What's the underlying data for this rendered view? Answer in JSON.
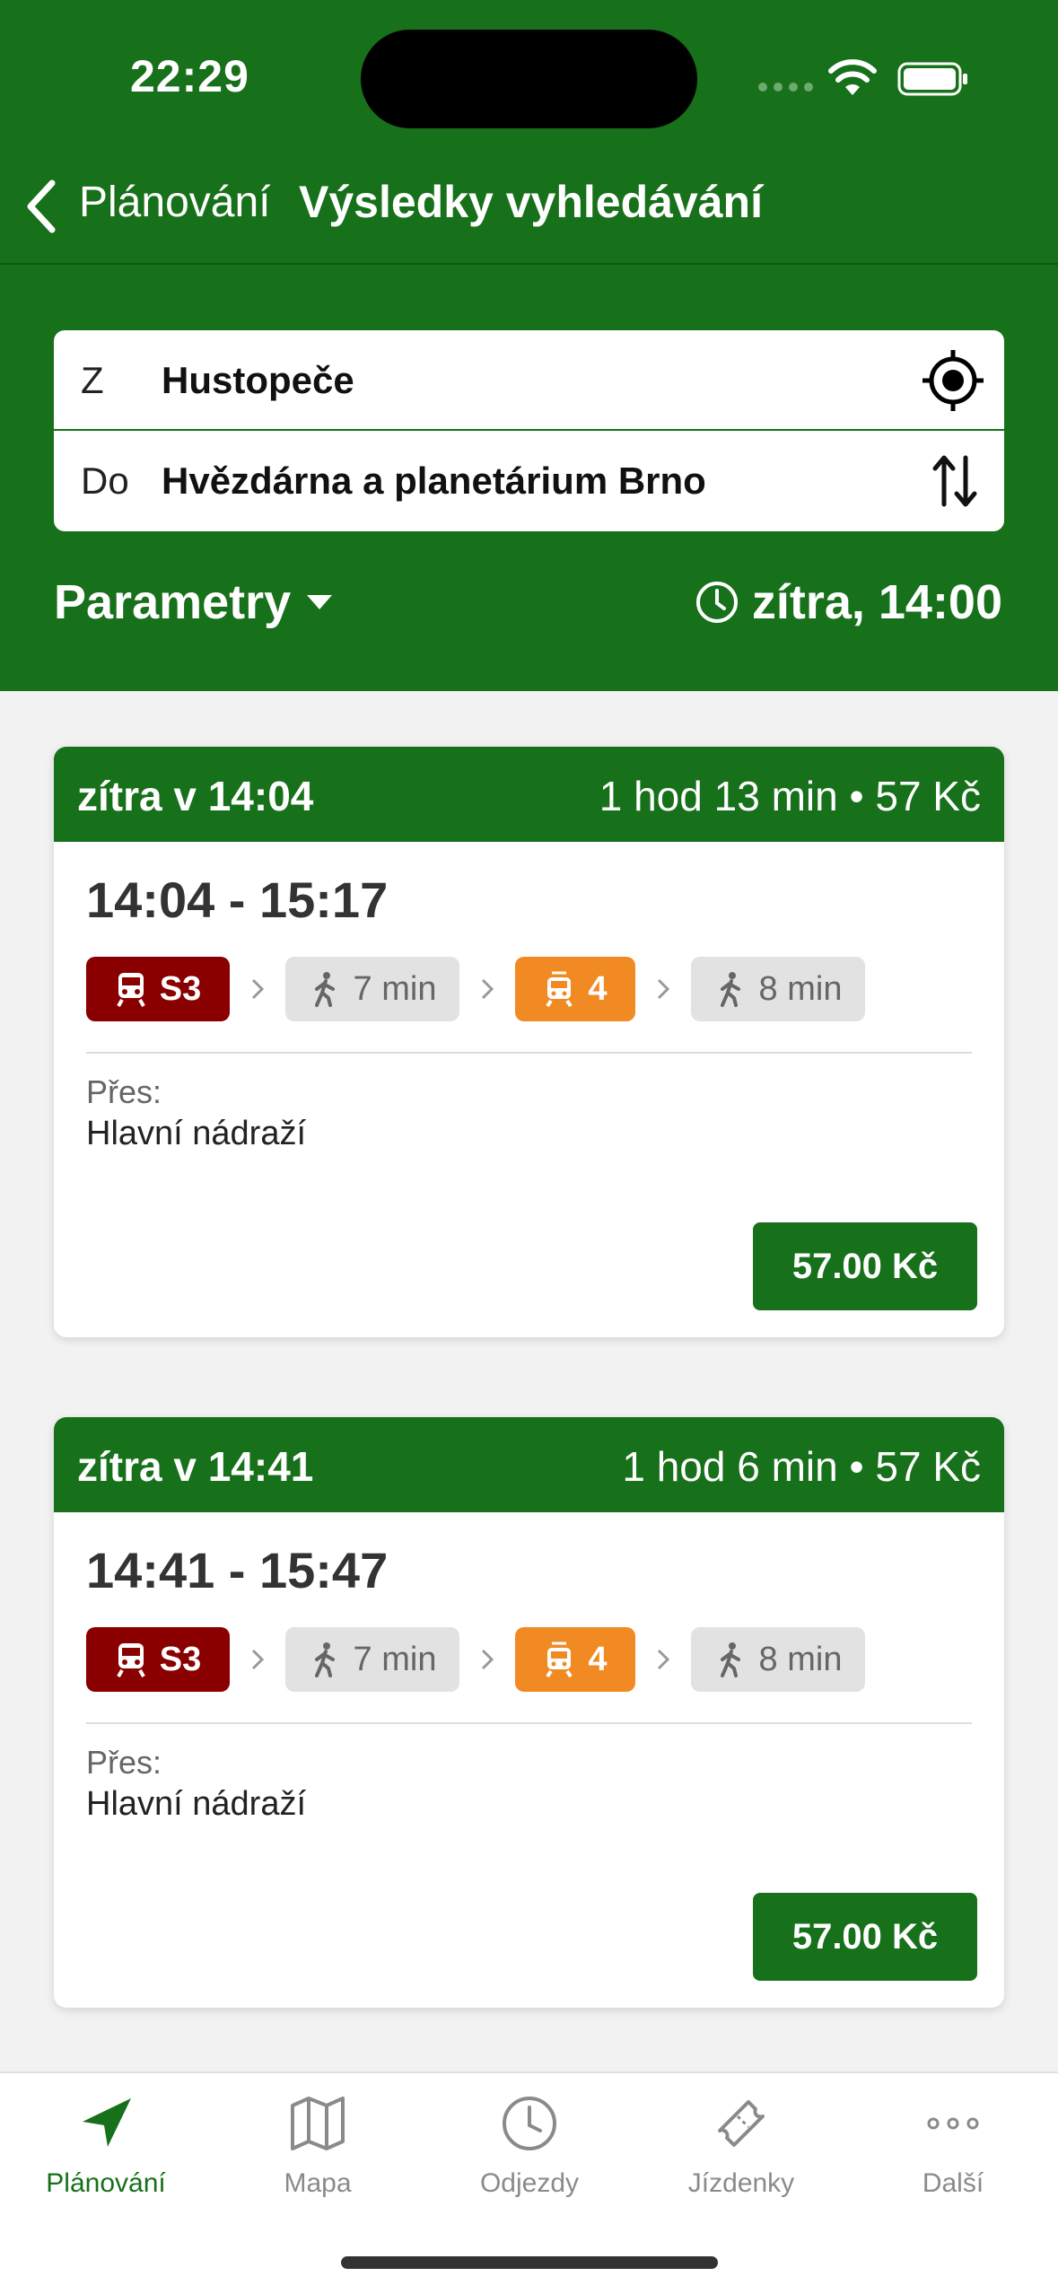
{
  "status_bar": {
    "time": "22:29"
  },
  "nav": {
    "back_label": "Plánování",
    "title": "Výsledky vyhledávání"
  },
  "route": {
    "from_prefix": "Z",
    "from_value": "Hustopeče",
    "to_prefix": "Do",
    "to_value": "Hvězdárna a planetárium Brno"
  },
  "params": {
    "label": "Parametry",
    "datetime": "zítra, 14:00"
  },
  "results": [
    {
      "header_left": "zítra v 14:04",
      "header_right": "1 hod 13 min • 57 Kč",
      "times": "14:04 - 15:17",
      "leg_train": "S3",
      "leg_walk1": "7 min",
      "leg_tram": "4",
      "leg_walk2": "8 min",
      "via_label": "Přes:",
      "via_value": "Hlavní nádraží",
      "price": "57.00 Kč"
    },
    {
      "header_left": "zítra v 14:41",
      "header_right": "1 hod 6 min • 57 Kč",
      "times": "14:41 - 15:47",
      "leg_train": "S3",
      "leg_walk1": "7 min",
      "leg_tram": "4",
      "leg_walk2": "8 min",
      "via_label": "Přes:",
      "via_value": "Hlavní nádraží",
      "price": "57.00 Kč"
    }
  ],
  "tabs": [
    {
      "label": "Plánování",
      "icon": "navigation-arrow-icon"
    },
    {
      "label": "Mapa",
      "icon": "map-icon"
    },
    {
      "label": "Odjezdy",
      "icon": "clock-icon"
    },
    {
      "label": "Jízdenky",
      "icon": "ticket-icon"
    },
    {
      "label": "Další",
      "icon": "more-dots-icon"
    }
  ],
  "colors": {
    "brand_green": "#17701a",
    "train_red": "#8a0000",
    "tram_orange": "#f18a22",
    "walk_gray": "#e2e2e2"
  }
}
